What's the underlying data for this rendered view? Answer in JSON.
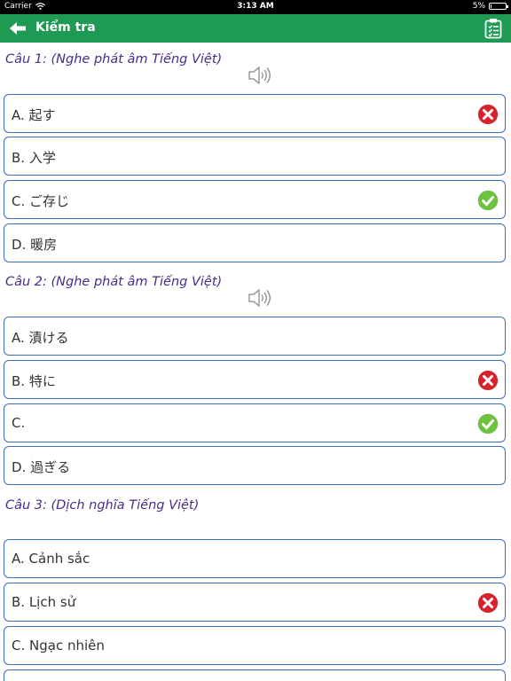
{
  "status_bar": {
    "carrier": "Carrier",
    "time": "3:13 AM",
    "battery": "5%",
    "battery_level": 0.05
  },
  "nav": {
    "title": "Kiểm tra",
    "back_icon": "back-arrow-icon",
    "clipboard_icon": "clipboard-list-icon"
  },
  "questions": [
    {
      "title": "Câu 1: (Nghe phát âm Tiếng Việt)",
      "options": [
        {
          "label": "A. 起す",
          "mark": "wrong"
        },
        {
          "label": "B. 入学",
          "mark": ""
        },
        {
          "label": "C. ご存じ",
          "mark": "correct"
        },
        {
          "label": "D. 暖房",
          "mark": ""
        }
      ]
    },
    {
      "title": "Câu 2: (Nghe phát âm Tiếng Việt)",
      "options": [
        {
          "label": "A. 漬ける",
          "mark": ""
        },
        {
          "label": "B. 特に",
          "mark": "wrong"
        },
        {
          "label": "C.",
          "mark": "correct"
        },
        {
          "label": "D. 過ぎる",
          "mark": ""
        }
      ]
    },
    {
      "title": "Câu 3: (Dịch nghĩa Tiếng Việt)",
      "options": [
        {
          "label": "A. Cảnh sắc",
          "mark": ""
        },
        {
          "label": "B. Lịch sử",
          "mark": "wrong"
        },
        {
          "label": "C. Ngạc nhiên",
          "mark": ""
        },
        {
          "label": "",
          "mark": ""
        }
      ]
    }
  ],
  "colors": {
    "nav_green": "#1e9a54",
    "question_purple": "#4b2b8a",
    "option_border": "#3d6fb6",
    "correct_green": "#6cc43c",
    "wrong_red": "#d9232c"
  }
}
